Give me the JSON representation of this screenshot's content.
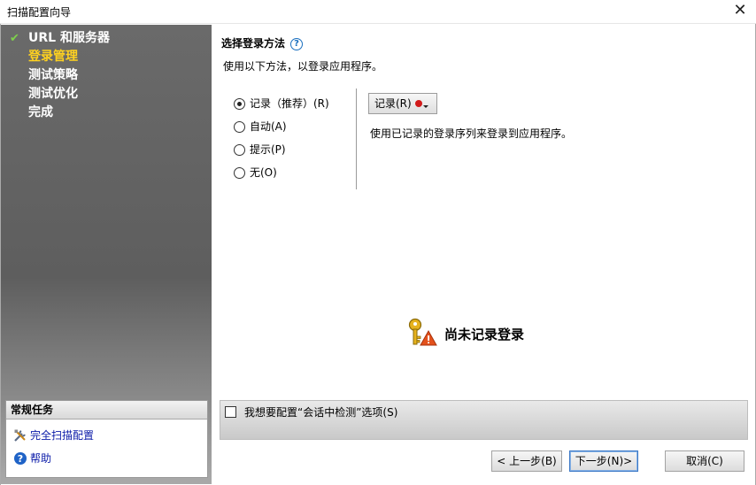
{
  "window": {
    "title": "扫描配置向导",
    "close_glyph": "✕"
  },
  "sidebar": {
    "steps": [
      {
        "label": "URL 和服务器",
        "state": "done"
      },
      {
        "label": "登录管理",
        "state": "current"
      },
      {
        "label": "测试策略",
        "state": "pending"
      },
      {
        "label": "测试优化",
        "state": "pending"
      },
      {
        "label": "完成",
        "state": "pending"
      }
    ],
    "tasks": {
      "header": "常规任务",
      "items": [
        {
          "label": "完全扫描配置",
          "icon": "tools-icon"
        },
        {
          "label": "帮助",
          "icon": "help-icon"
        }
      ]
    }
  },
  "main": {
    "heading": "选择登录方法",
    "help_glyph": "?",
    "subtitle": "使用以下方法，以登录应用程序。",
    "options": [
      {
        "label": "记录（推荐）(R)",
        "selected": true
      },
      {
        "label": "自动(A)",
        "selected": false
      },
      {
        "label": "提示(P)",
        "selected": false
      },
      {
        "label": "无(O)",
        "selected": false
      }
    ],
    "record_button": "记录(R)",
    "record_description": "使用已记录的登录序列来登录到应用程序。",
    "status_text": "尚未记录登录",
    "session_checkbox_label": "我想要配置“会话中检测”选项(S)",
    "session_checkbox_checked": false
  },
  "buttons": {
    "prev": "< 上一步(B)",
    "next": "下一步(N)>",
    "cancel": "取消(C)"
  },
  "colors": {
    "current_step": "#ffd21f",
    "check": "#7ed04c",
    "link": "#0a1aa8",
    "record_dot": "#d11a1a"
  }
}
